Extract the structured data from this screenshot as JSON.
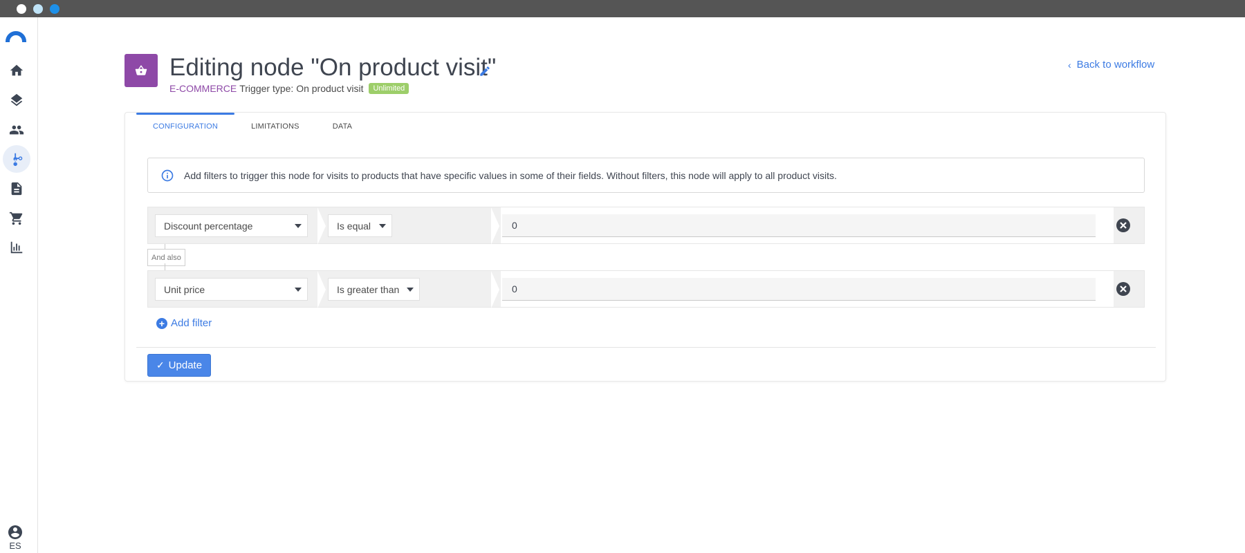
{
  "sidebar": {
    "nav_items": [
      {
        "name": "home",
        "active": false
      },
      {
        "name": "layers",
        "active": false
      },
      {
        "name": "people",
        "active": false
      },
      {
        "name": "workflow",
        "active": true
      },
      {
        "name": "document",
        "active": false
      },
      {
        "name": "cart",
        "active": false
      },
      {
        "name": "chart",
        "active": false
      }
    ],
    "language": "ES"
  },
  "header": {
    "title": "Editing node \"On product visit\"",
    "category": "E-COMMERCE",
    "trigger_type": "Trigger type: On product visit",
    "badge": "Unlimited",
    "back_link": "Back to workflow"
  },
  "tabs": [
    {
      "label": "CONFIGURATION",
      "active": true
    },
    {
      "label": "LIMITATIONS",
      "active": false
    },
    {
      "label": "DATA",
      "active": false
    }
  ],
  "info": {
    "text": "Add filters to trigger this node for visits to products that have specific values in some of their fields. Without filters, this node will apply to all product visits."
  },
  "filters": [
    {
      "field": "Discount percentage",
      "operator": "Is equal",
      "value": "0"
    },
    {
      "field": "Unit price",
      "operator": "Is greater than",
      "value": "0"
    }
  ],
  "connector_label": "And also",
  "add_filter_label": "Add filter",
  "update_label": "Update",
  "colors": {
    "accent": "#3c7be3",
    "node_icon": "#8e49a7",
    "badge": "#9dce6a"
  }
}
